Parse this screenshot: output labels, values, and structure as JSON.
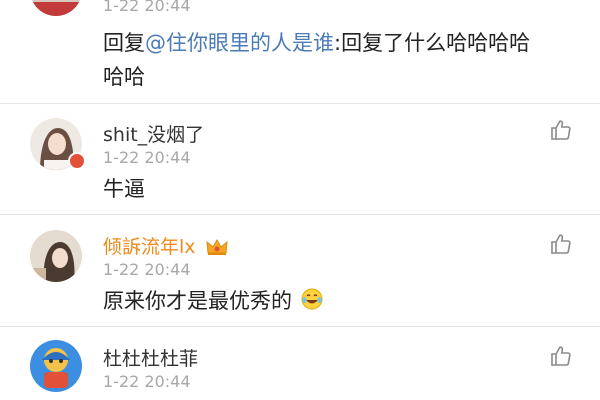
{
  "comments": [
    {
      "time": "1-22 20:44",
      "reply_prefix": "回复",
      "mention": "@住你眼里的人是谁",
      "reply_suffix": ":回复了什么哈哈哈哈",
      "reply_line2": "哈哈"
    },
    {
      "name": "shit_没烟了",
      "time": "1-22 20:44",
      "text": "牛逼"
    },
    {
      "name": "倾訴流年lx",
      "time": "1-22 20:44",
      "text": "原来你才是最优秀的",
      "vip_badge": "crown-icon",
      "emoji": "laugh-cry-emoji"
    },
    {
      "name": "杜杜杜杜菲",
      "time": "1-22 20:44"
    }
  ],
  "icons": {
    "like": "thumbs-up-icon",
    "level_badge": "level-badge-icon"
  },
  "colors": {
    "vip_name": "#f08a1c",
    "mention": "#4a7bb7",
    "time": "#a8a8a8"
  }
}
